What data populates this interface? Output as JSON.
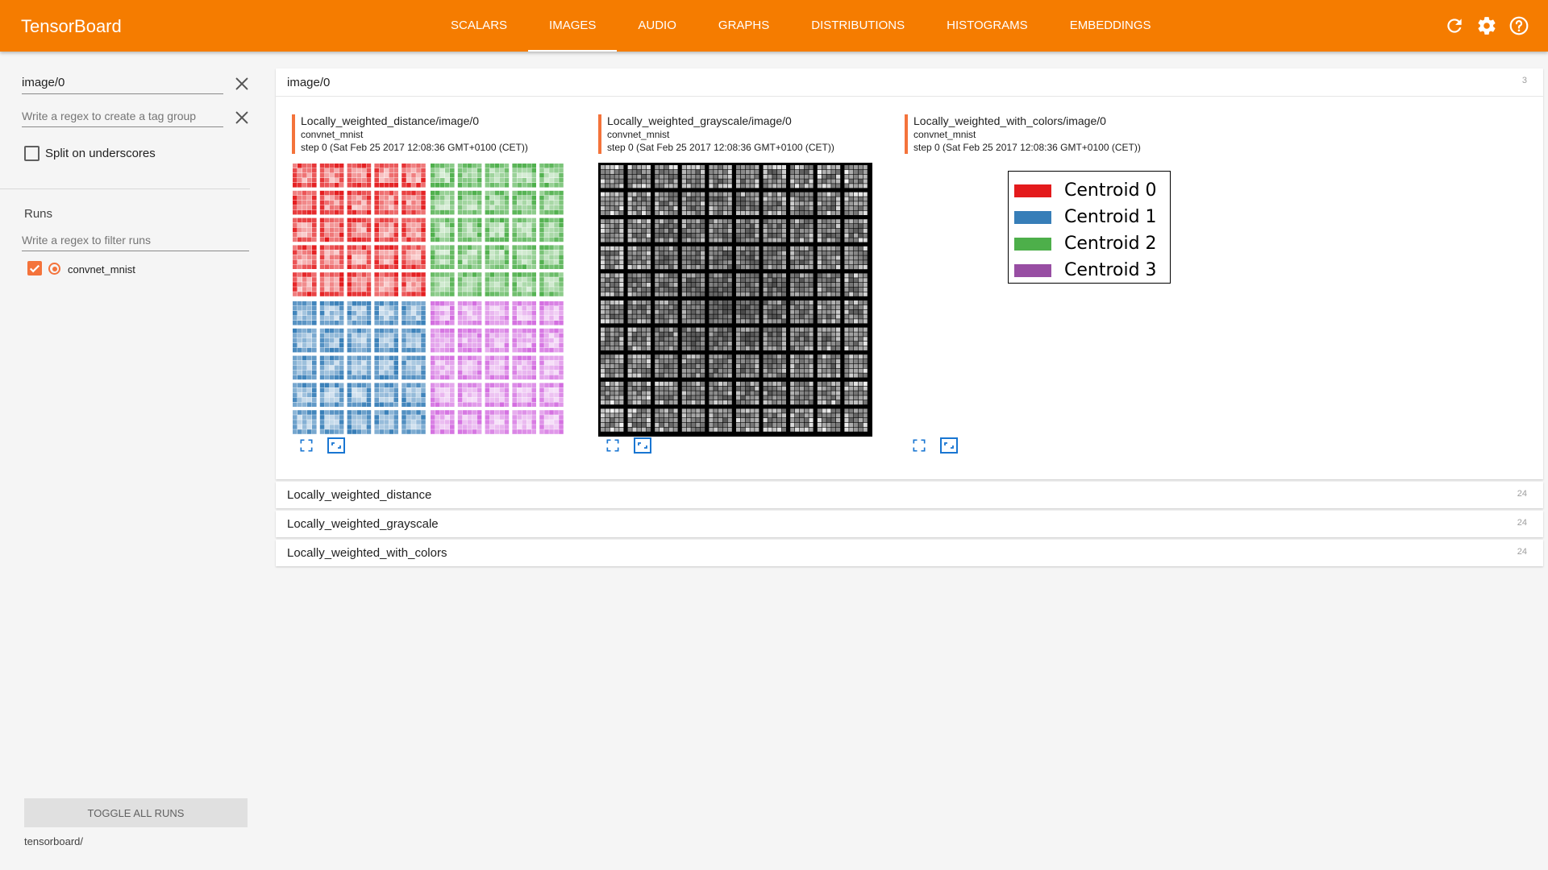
{
  "header": {
    "brand": "TensorBoard",
    "tabs": [
      {
        "label": "SCALARS",
        "active": false
      },
      {
        "label": "IMAGES",
        "active": true
      },
      {
        "label": "AUDIO",
        "active": false
      },
      {
        "label": "GRAPHS",
        "active": false
      },
      {
        "label": "DISTRIBUTIONS",
        "active": false
      },
      {
        "label": "HISTOGRAMS",
        "active": false
      },
      {
        "label": "EMBEDDINGS",
        "active": false
      }
    ],
    "icons": [
      "refresh-icon",
      "settings-gear-icon",
      "help-icon"
    ]
  },
  "sidebar": {
    "tag_filter_value": "image/0",
    "tag_group_placeholder": "Write a regex to create a tag group",
    "split_underscores_label": "Split on underscores",
    "split_underscores_checked": false,
    "runs_label": "Runs",
    "run_filter_placeholder": "Write a regex to filter runs",
    "runs": [
      {
        "name": "convnet_mnist",
        "checked": true,
        "color": "#f4733b"
      }
    ],
    "toggle_all_label": "TOGGLE ALL RUNS",
    "logdir": "tensorboard/"
  },
  "main": {
    "expanded_pane": {
      "title": "image/0",
      "count": "3",
      "cards": [
        {
          "tag": "Locally_weighted_distance/image/0",
          "run": "convnet_mnist",
          "step": "step 0 (Sat Feb 25 2017 12:08:36 GMT+0100 (CET))",
          "image": "colored-mnist-grid"
        },
        {
          "tag": "Locally_weighted_grayscale/image/0",
          "run": "convnet_mnist",
          "step": "step 0 (Sat Feb 25 2017 12:08:36 GMT+0100 (CET))",
          "image": "grayscale-mnist-grid"
        },
        {
          "tag": "Locally_weighted_with_colors/image/0",
          "run": "convnet_mnist",
          "step": "step 0 (Sat Feb 25 2017 12:08:36 GMT+0100 (CET))",
          "image": "centroid-legend",
          "legend": [
            {
              "label": "Centroid 0",
              "color": "#e41a1c"
            },
            {
              "label": "Centroid 1",
              "color": "#377eb8"
            },
            {
              "label": "Centroid 2",
              "color": "#4daf4a"
            },
            {
              "label": "Centroid 3",
              "color": "#984ea3"
            }
          ]
        }
      ]
    },
    "collapsed_panes": [
      {
        "title": "Locally_weighted_distance",
        "count": "24"
      },
      {
        "title": "Locally_weighted_grayscale",
        "count": "24"
      },
      {
        "title": "Locally_weighted_with_colors",
        "count": "24"
      }
    ]
  },
  "colors": {
    "accent": "#f57c00",
    "run": "#f4733b",
    "icon_blue": "#1976d2"
  }
}
